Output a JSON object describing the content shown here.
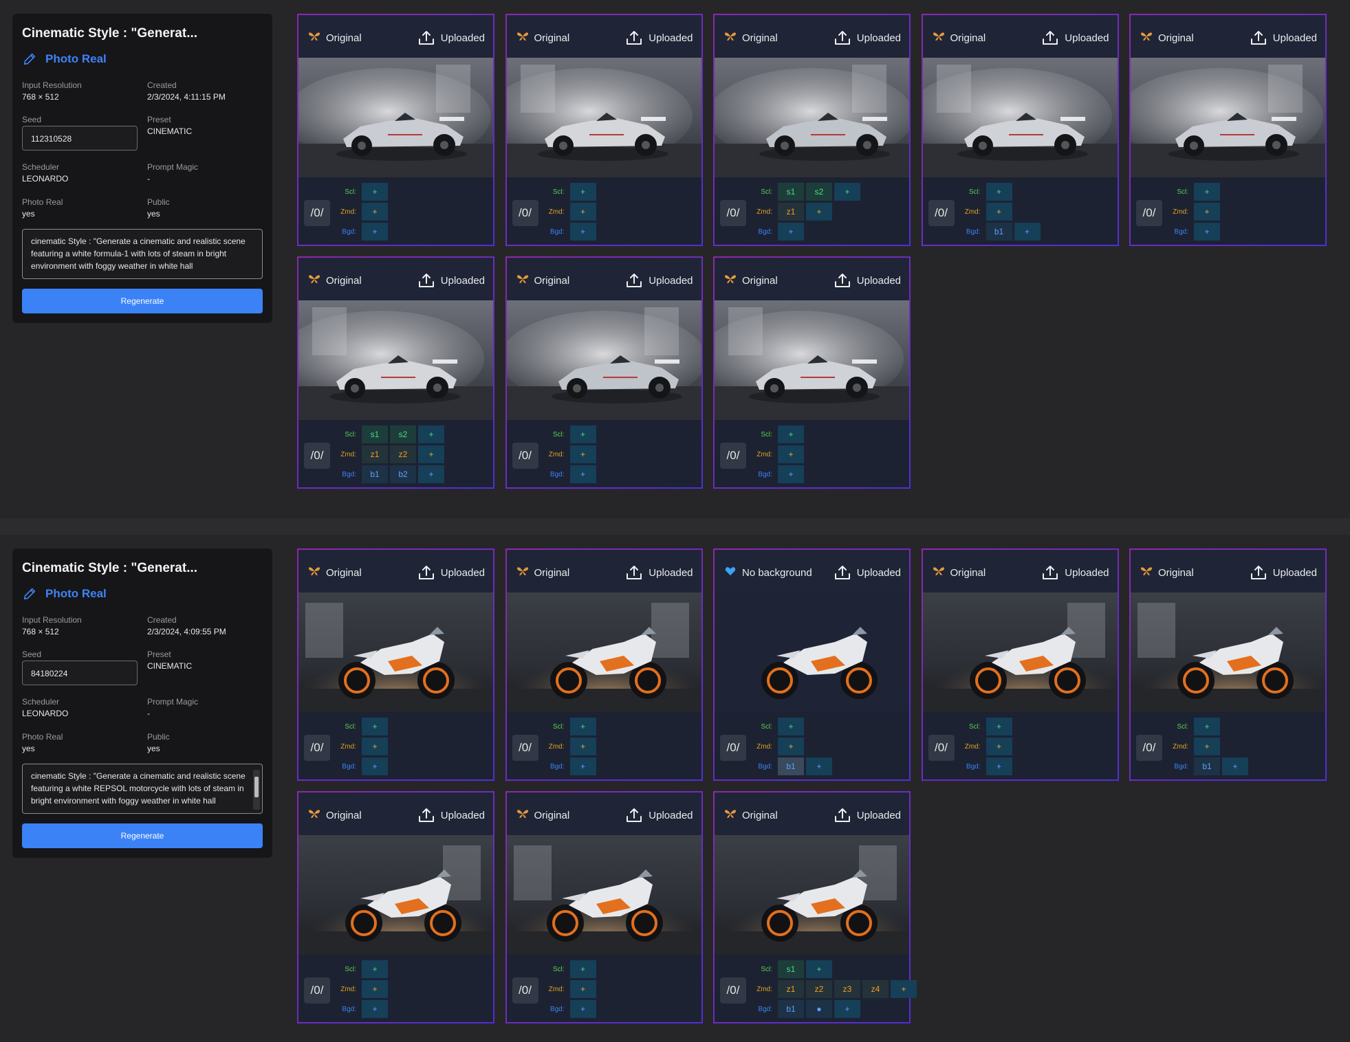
{
  "labels": {
    "input_resolution": "Input Resolution",
    "created": "Created",
    "seed": "Seed",
    "preset": "Preset",
    "scheduler": "Scheduler",
    "prompt_magic": "Prompt Magic",
    "photo_real": "Photo Real",
    "public": "Public",
    "regenerate": "Regenerate",
    "uploaded": "Uploaded",
    "zoom": "/0/",
    "scl": "Scl:",
    "zmd": "Zmd:",
    "bgd": "Bgd:",
    "add": "+"
  },
  "generations": [
    {
      "title": "Cinematic Style : \"Generat...",
      "preset_link": "Photo Real",
      "input_resolution": "768 × 512",
      "created": "2/3/2024, 4:11:15 PM",
      "seed": "112310528",
      "preset": "CINEMATIC",
      "scheduler": "LEONARDO",
      "prompt_magic": "-",
      "photo_real": "yes",
      "public": "yes",
      "prompt": "cinematic Style : \"Generate a cinematic and realistic scene featuring a white formula-1 with lots of steam in bright environment with foggy weather in white hall",
      "subject": "car",
      "images": [
        {
          "tag": "Original",
          "tag_icon": "butterfly-icon",
          "scl": [],
          "zmd": [],
          "bgd": []
        },
        {
          "tag": "Original",
          "tag_icon": "butterfly-icon",
          "scl": [],
          "zmd": [],
          "bgd": []
        },
        {
          "tag": "Original",
          "tag_icon": "butterfly-icon",
          "scl": [
            "s1",
            "s2"
          ],
          "zmd": [
            "z1"
          ],
          "bgd": []
        },
        {
          "tag": "Original",
          "tag_icon": "butterfly-icon",
          "scl": [],
          "zmd": [],
          "bgd": [
            "b1"
          ]
        },
        {
          "tag": "Original",
          "tag_icon": "butterfly-icon",
          "scl": [],
          "zmd": [],
          "bgd": []
        },
        {
          "tag": "Original",
          "tag_icon": "butterfly-icon",
          "scl": [
            "s1",
            "s2"
          ],
          "zmd": [
            "z1",
            "z2"
          ],
          "bgd": [
            "b1",
            "b2"
          ]
        },
        {
          "tag": "Original",
          "tag_icon": "butterfly-icon",
          "scl": [],
          "zmd": [],
          "bgd": []
        },
        {
          "tag": "Original",
          "tag_icon": "butterfly-icon",
          "scl": [],
          "zmd": [],
          "bgd": []
        }
      ]
    },
    {
      "title": "Cinematic Style : \"Generat...",
      "preset_link": "Photo Real",
      "input_resolution": "768 × 512",
      "created": "2/3/2024, 4:09:55 PM",
      "seed": "84180224",
      "preset": "CINEMATIC",
      "scheduler": "LEONARDO",
      "prompt_magic": "-",
      "photo_real": "yes",
      "public": "yes",
      "prompt": "cinematic Style : \"Generate a cinematic and realistic scene featuring a white REPSOL motorcycle with lots of steam in bright environment with foggy weather in white hall",
      "subject": "bike",
      "images": [
        {
          "tag": "Original",
          "tag_icon": "butterfly-icon",
          "scl": [],
          "zmd": [],
          "bgd": []
        },
        {
          "tag": "Original",
          "tag_icon": "butterfly-icon",
          "scl": [],
          "zmd": [],
          "bgd": []
        },
        {
          "tag": "No background",
          "tag_icon": "blue-heart-icon",
          "scl": [],
          "zmd": [],
          "bgd": [
            "b1"
          ],
          "bgd_selected": true
        },
        {
          "tag": "Original",
          "tag_icon": "butterfly-icon",
          "scl": [],
          "zmd": [],
          "bgd": []
        },
        {
          "tag": "Original",
          "tag_icon": "butterfly-icon",
          "scl": [],
          "zmd": [],
          "bgd": [
            "b1"
          ]
        },
        {
          "tag": "Original",
          "tag_icon": "butterfly-icon",
          "scl": [],
          "zmd": [],
          "bgd": []
        },
        {
          "tag": "Original",
          "tag_icon": "butterfly-icon",
          "scl": [],
          "zmd": [],
          "bgd": []
        },
        {
          "tag": "Original",
          "tag_icon": "butterfly-icon",
          "scl": [
            "s1"
          ],
          "zmd": [
            "z1",
            "z2",
            "z3",
            "z4"
          ],
          "bgd": [
            "b1",
            "●"
          ]
        }
      ]
    }
  ]
}
